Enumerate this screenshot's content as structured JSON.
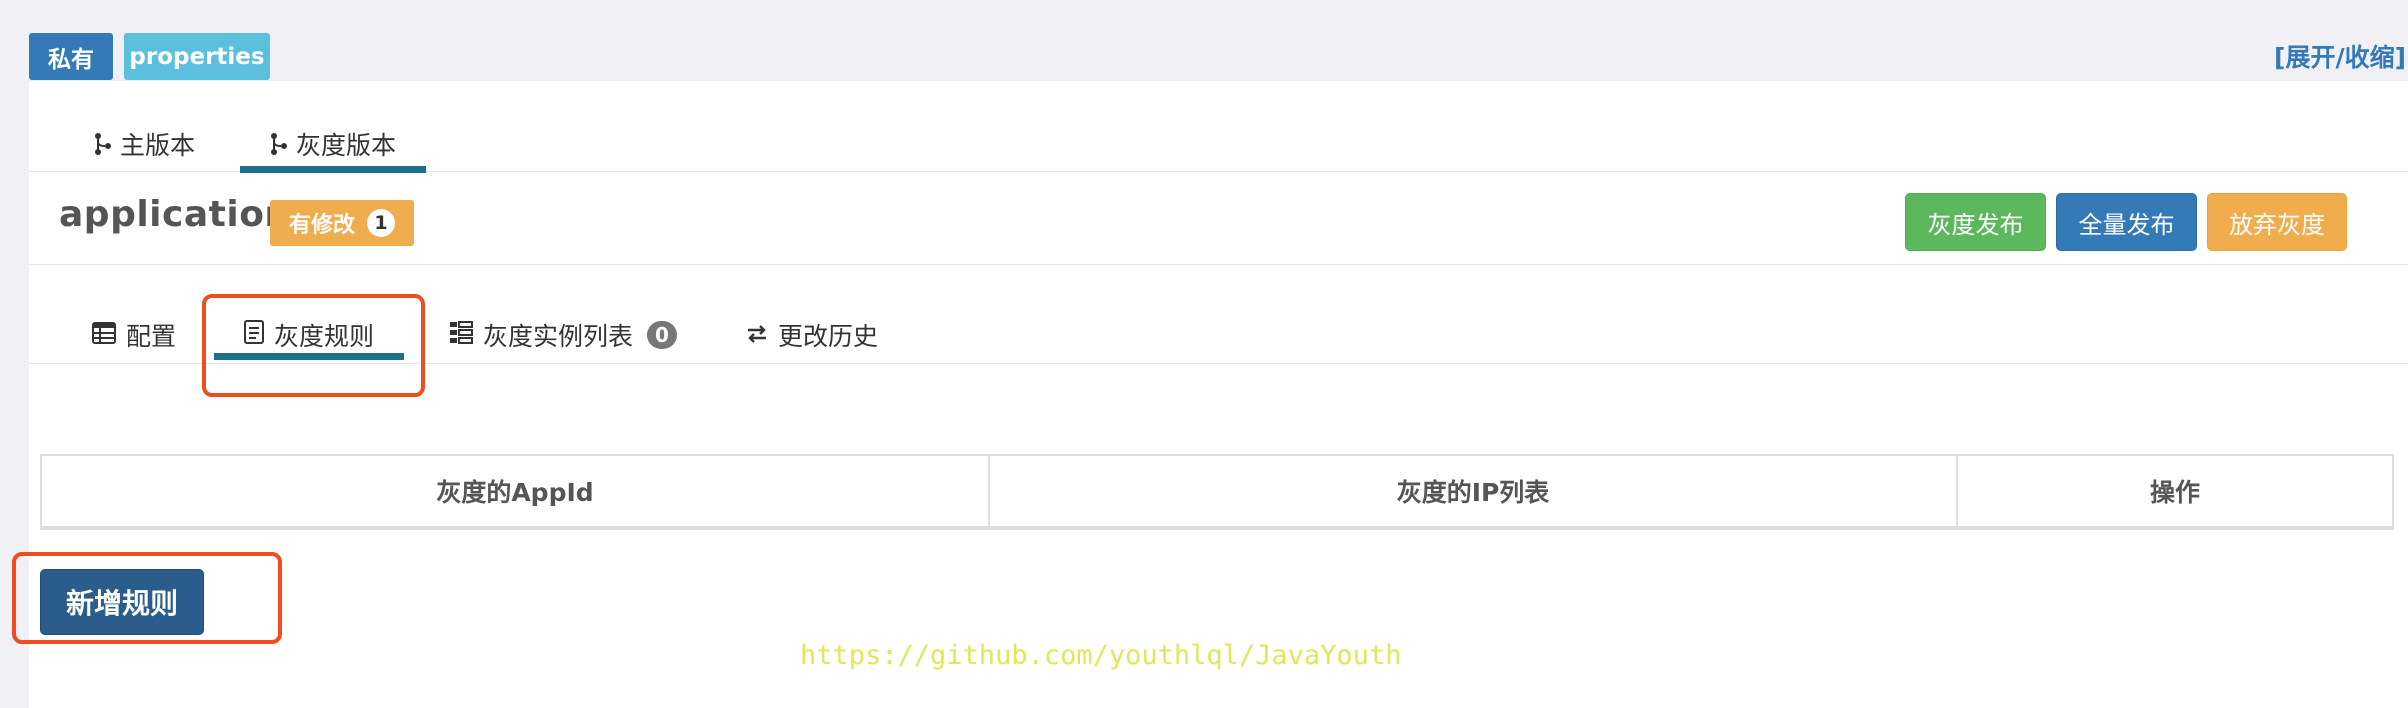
{
  "header": {
    "scope_label": "私有",
    "format_label": "properties",
    "toggle_link": "[展开/收缩]"
  },
  "branch_tabs": [
    {
      "label": "主版本",
      "icon": "branch-icon"
    },
    {
      "label": "灰度版本",
      "icon": "branch-icon",
      "active": true
    }
  ],
  "namespace": {
    "name": "application",
    "modified_label": "有修改",
    "modified_count": "1"
  },
  "actions": {
    "gray_release": "灰度发布",
    "full_release": "全量发布",
    "abandon_gray": "放弃灰度"
  },
  "sub_tabs": [
    {
      "label": "配置",
      "icon": "table-icon"
    },
    {
      "label": "灰度规则",
      "icon": "document-icon",
      "active": true
    },
    {
      "label": "灰度实例列表",
      "icon": "list-icon",
      "badge": "0"
    },
    {
      "label": "更改历史",
      "icon": "swap-icon"
    }
  ],
  "rules_table": {
    "columns": [
      "灰度的AppId",
      "灰度的IP列表",
      "操作"
    ]
  },
  "add_rule_label": "新增规则",
  "watermark": "https://github.com/youthlql/JavaYouth",
  "colors": {
    "primary": "#337ab7",
    "info": "#5bc0de",
    "success": "#5cb85c",
    "warning": "#f0ad4e",
    "highlight": "#ee4e1d",
    "tab_underline": "#1f6f8b"
  }
}
